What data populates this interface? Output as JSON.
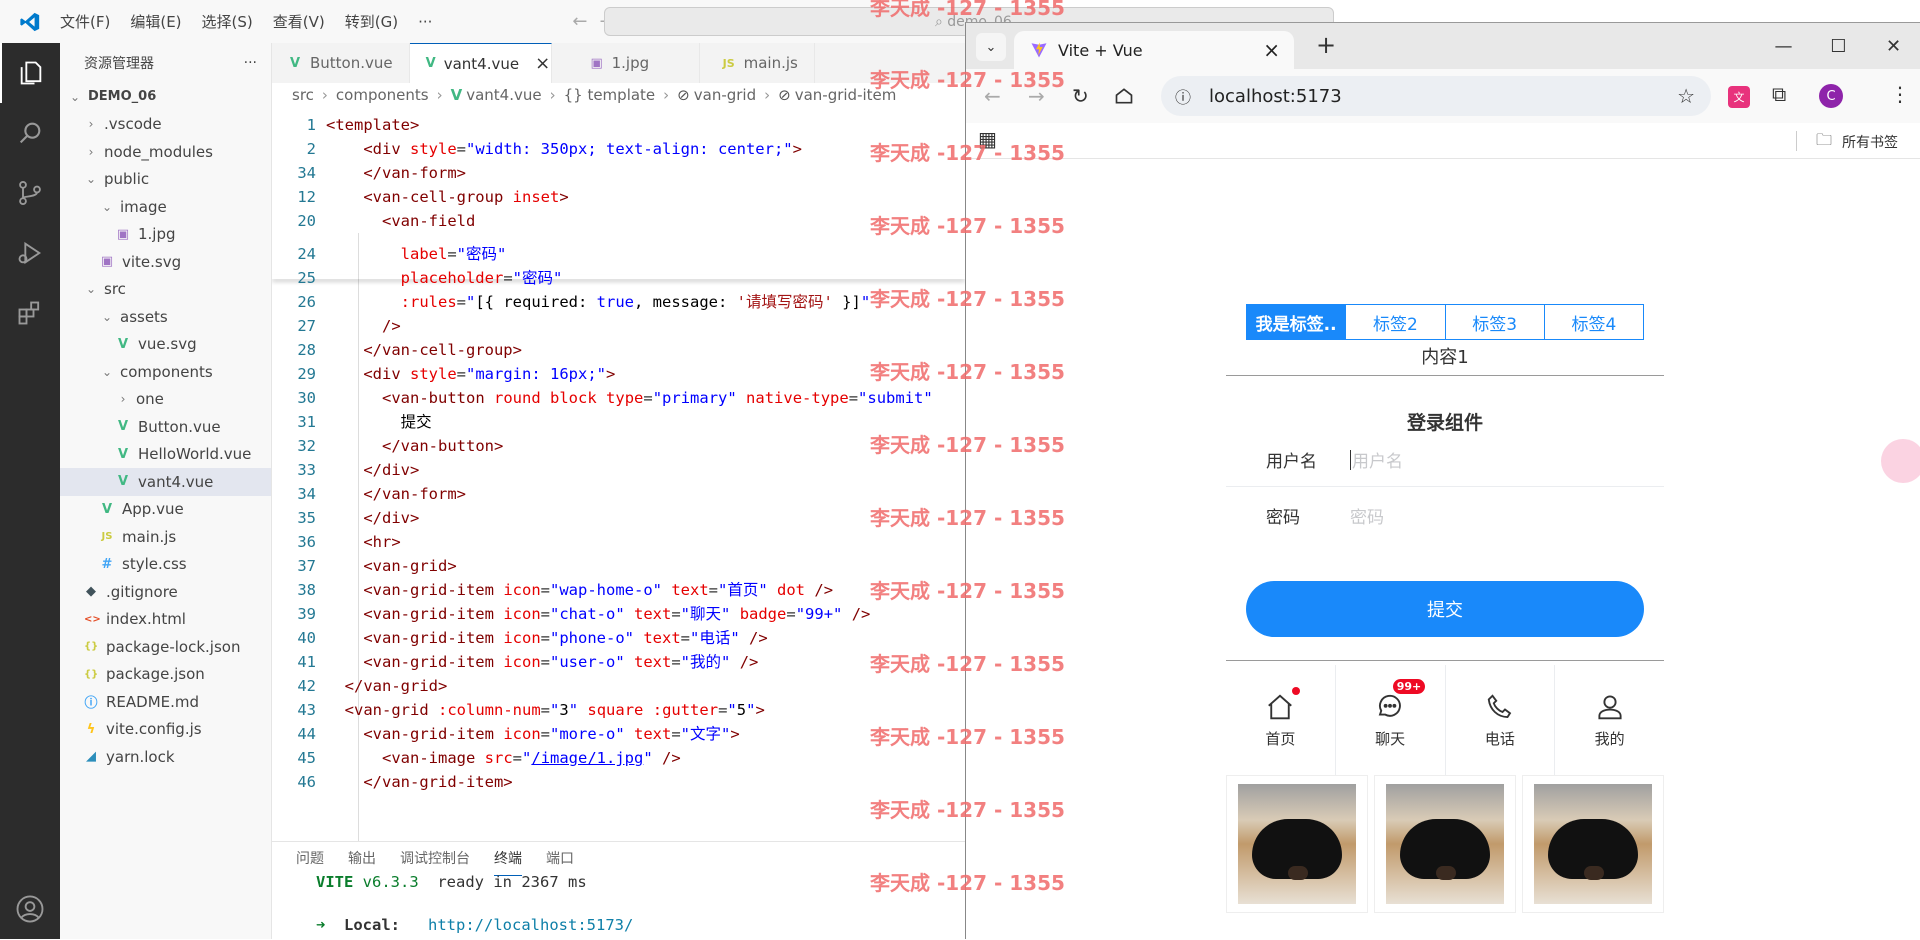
{
  "vscode": {
    "menu": [
      "文件(F)",
      "编辑(E)",
      "选择(S)",
      "查看(V)",
      "转到(G)",
      "···"
    ],
    "search": "demo_06",
    "explorer": {
      "title": "资源管理器",
      "more": "···",
      "items": [
        {
          "label": "DEMO_06",
          "type": "root",
          "indent": 0,
          "tw": "⌄"
        },
        {
          "label": ".vscode",
          "type": "folder",
          "indent": 1,
          "tw": "›"
        },
        {
          "label": "node_modules",
          "type": "folder",
          "indent": 1,
          "tw": "›"
        },
        {
          "label": "public",
          "type": "folder",
          "indent": 1,
          "tw": "⌄"
        },
        {
          "label": "image",
          "type": "folder",
          "indent": 2,
          "tw": "⌄"
        },
        {
          "label": "1.jpg",
          "type": "img",
          "indent": 3
        },
        {
          "label": "vite.svg",
          "type": "img",
          "indent": 2
        },
        {
          "label": "src",
          "type": "folder",
          "indent": 1,
          "tw": "⌄"
        },
        {
          "label": "assets",
          "type": "folder",
          "indent": 2,
          "tw": "⌄"
        },
        {
          "label": "vue.svg",
          "type": "vue",
          "indent": 3
        },
        {
          "label": "components",
          "type": "folder",
          "indent": 2,
          "tw": "⌄"
        },
        {
          "label": "one",
          "type": "folder",
          "indent": 3,
          "tw": "›"
        },
        {
          "label": "Button.vue",
          "type": "vue",
          "indent": 3
        },
        {
          "label": "HelloWorld.vue",
          "type": "vue",
          "indent": 3
        },
        {
          "label": "vant4.vue",
          "type": "vue",
          "indent": 3,
          "selected": true
        },
        {
          "label": "App.vue",
          "type": "vue",
          "indent": 2
        },
        {
          "label": "main.js",
          "type": "js",
          "indent": 2
        },
        {
          "label": "style.css",
          "type": "css",
          "indent": 2
        },
        {
          "label": ".gitignore",
          "type": "git",
          "indent": 1
        },
        {
          "label": "index.html",
          "type": "html",
          "indent": 1
        },
        {
          "label": "package-lock.json",
          "type": "json",
          "indent": 1
        },
        {
          "label": "package.json",
          "type": "json",
          "indent": 1
        },
        {
          "label": "README.md",
          "type": "info",
          "indent": 1
        },
        {
          "label": "vite.config.js",
          "type": "vite",
          "indent": 1
        },
        {
          "label": "yarn.lock",
          "type": "yarn",
          "indent": 1
        }
      ]
    },
    "tabs": [
      {
        "label": "Button.vue",
        "icon": "vue"
      },
      {
        "label": "vant4.vue",
        "icon": "vue",
        "active": true,
        "close": "×"
      },
      {
        "label": "1.jpg",
        "icon": "img"
      },
      {
        "label": "main.js",
        "icon": "js"
      }
    ],
    "breadcrumb": [
      "src",
      "components",
      "vant4.vue",
      "{} template",
      "van-grid",
      "van-grid-item"
    ],
    "panel_tabs": [
      "问题",
      "输出",
      "调试控制台",
      "终端",
      "端口"
    ],
    "terminal": {
      "vite": "VITE",
      "version": "v6.3.3",
      "ready": "ready in 2367 ms",
      "arrow": "➜",
      "local_label": "Local:",
      "local_url": "http://localhost:5173/"
    }
  },
  "watermark": "李天成 -127 - 1355",
  "browser": {
    "tab_title": "Vite + Vue",
    "tab_close": "×",
    "new_tab": "+",
    "url": "localhost:5173",
    "bookmarks_label": "所有书签",
    "profile": "C",
    "vant_tabs": [
      "我是标签..",
      "标签2",
      "标签3",
      "标签4"
    ],
    "content": "内容1",
    "login_title": "登录组件",
    "username_label": "用户名",
    "username_placeholder": "用户名",
    "password_label": "密码",
    "password_placeholder": "密码",
    "submit": "提交",
    "grid": [
      {
        "label": "首页",
        "dot": true
      },
      {
        "label": "聊天",
        "badge": "99+"
      },
      {
        "label": "电话"
      },
      {
        "label": "我的"
      }
    ]
  }
}
